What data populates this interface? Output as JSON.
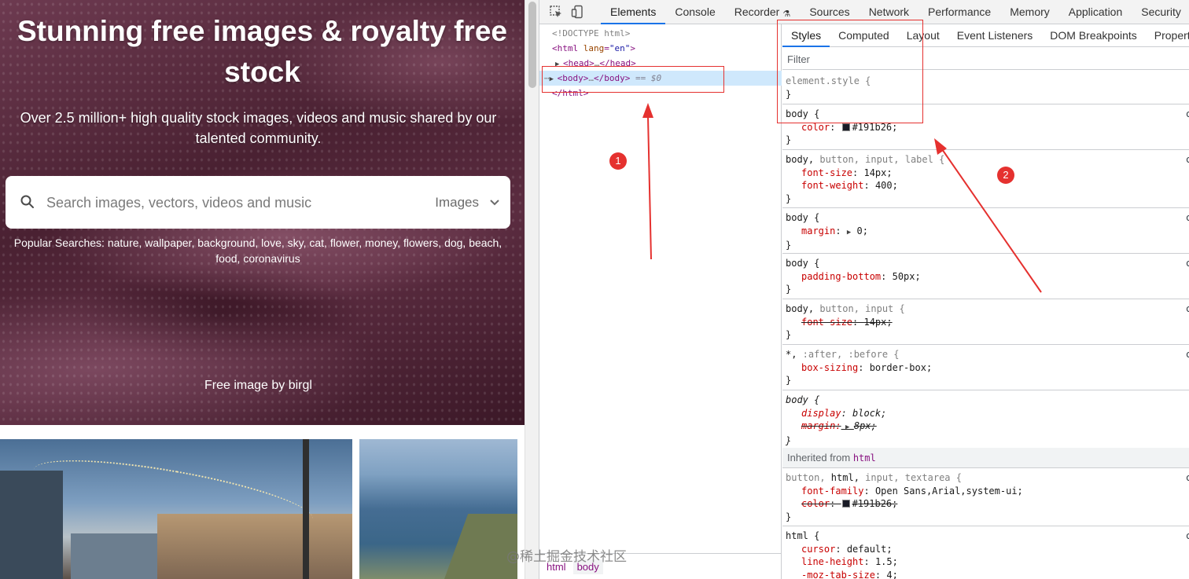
{
  "page": {
    "hero_title": "Stunning free images & royalty free stock",
    "hero_subtitle": "Over 2.5 million+ high quality stock images, videos and music shared by our talented community.",
    "search": {
      "placeholder": "Search images, vectors, videos and music",
      "type_label": "Images"
    },
    "popular_searches": "Popular Searches: nature, wallpaper, background, love, sky, cat, flower, money, flowers, dog, beach, food, coronavirus",
    "hero_credit": "Free image by birgl"
  },
  "devtools": {
    "tabs": [
      "Elements",
      "Console",
      "Recorder",
      "Sources",
      "Network",
      "Performance",
      "Memory",
      "Application",
      "Security"
    ],
    "active_tab": "Elements",
    "dom": {
      "doctype": "<!DOCTYPE html>",
      "html_open_tag": "html",
      "html_attr_name": "lang",
      "html_attr_value": "\"en\"",
      "head_line": "head",
      "body_line": "body",
      "body_marker": "== $0",
      "html_close": "</html>"
    },
    "breadcrumbs": [
      "html",
      "body"
    ],
    "styles_tabs": [
      "Styles",
      "Computed",
      "Layout",
      "Event Listeners",
      "DOM Breakpoints",
      "Properties"
    ],
    "filter_placeholder": "Filter",
    "rules": {
      "r0_selector": "element.style {",
      "r1_selector": "body {",
      "r1_p1_name": "color",
      "r1_p1_value": "#191b26;",
      "r2_selector_main": "body,",
      "r2_selector_rest": " button, input, label {",
      "r2_p1_name": "font-size",
      "r2_p1_value": "14px;",
      "r2_p2_name": "font-weight",
      "r2_p2_value": "400;",
      "r3_selector": "body {",
      "r3_p1_name": "margin",
      "r3_p1_value": "0;",
      "r4_selector": "body {",
      "r4_p1_name": "padding-bottom",
      "r4_p1_value": "50px;",
      "r5_selector_main": "body,",
      "r5_selector_rest": " button, input {",
      "r5_p1_name": "font-size",
      "r5_p1_value": "14px;",
      "r6_selector_main": "*,",
      "r6_selector_rest": " :after, :before {",
      "r6_p1_name": "box-sizing",
      "r6_p1_value": "border-box;",
      "r7_selector": "body {",
      "r7_p1_name": "display",
      "r7_p1_value": "block;",
      "r7_p2_name": "margin:",
      "r7_p2_value": "8px;",
      "inherited_label": "Inherited from",
      "inherited_tag": "html",
      "r8_selector_rest": "button, ",
      "r8_selector_main": "html,",
      "r8_selector_rest2": " input, textarea {",
      "r8_p1_name": "font-family",
      "r8_p1_value": "Open Sans,Arial,system-ui;",
      "r8_p2_name": "color",
      "r8_p2_value": "#191b26;",
      "r9_selector": "html {",
      "r9_p1_name": "cursor",
      "r9_p1_value": "default;",
      "r9_p2_name": "line-height",
      "r9_p2_value": "1.5;",
      "r9_p3_name": "-moz-tab-size",
      "r9_p3_value": "4;",
      "close_brace": "}",
      "src_marker": "c"
    },
    "color_swatch": "#191b26"
  },
  "annotations": {
    "badge1": "1",
    "badge2": "2",
    "color": "#e5312f"
  },
  "watermark": "@稀土掘金技术社区"
}
